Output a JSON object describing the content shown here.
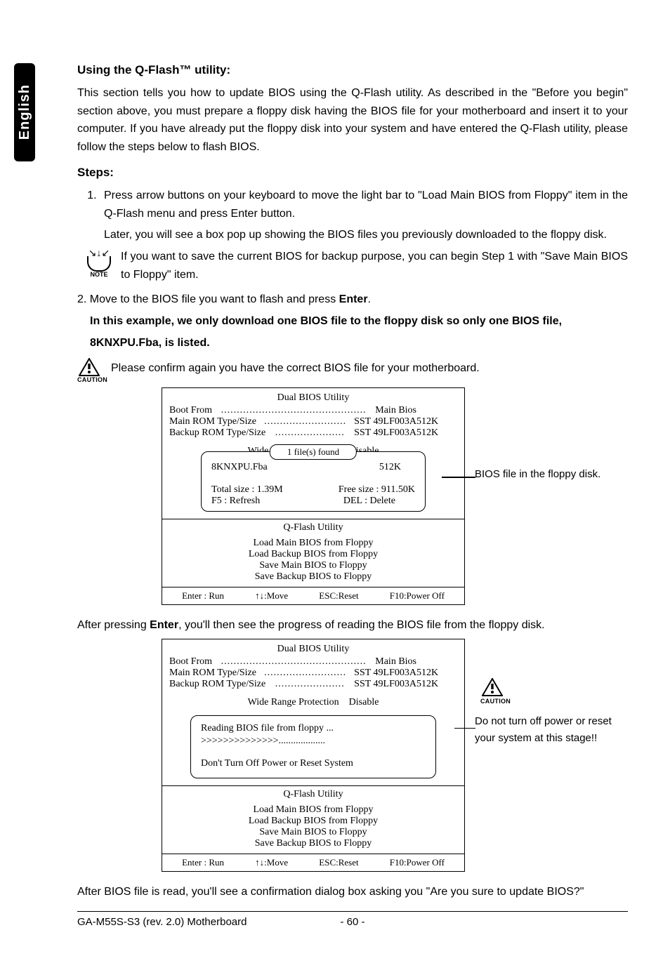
{
  "lang_tab": "English",
  "heading_qflash": "Using the Q-Flash™ utility:",
  "intro": "This section tells you how to update BIOS using the Q-Flash utility. As described in the \"Before you begin\" section above, you must prepare a floppy disk having the BIOS file for your motherboard and insert it to your computer. If you have already put the floppy disk into your system and have entered the Q-Flash utility, please follow the steps below to flash BIOS.",
  "steps_heading": "Steps:",
  "step1_a": "Press arrow buttons on your keyboard to move the light bar to \"Load Main BIOS from Floppy\" item in the Q-Flash menu and press Enter button.",
  "step1_b": "Later, you will see a box pop up showing the BIOS files you previously downloaded to the floppy disk.",
  "note_text": "If you want to save the current BIOS for backup purpose, you can begin Step 1 with \"Save Main BIOS to Floppy\" item.",
  "note_label": "NOTE",
  "step2_line": "2. Move to the BIOS file you want to flash and press ",
  "step2_enter": "Enter",
  "step2_period": ".",
  "bold1": "In this example, we only download one BIOS file to the floppy disk so only one BIOS file,",
  "bold2": "8KNXPU.Fba, is listed.",
  "caution_label": "CAUTION",
  "caution_text": "Please confirm again you have the correct BIOS file for your motherboard.",
  "bios": {
    "title": "Dual BIOS Utility",
    "bootfrom_l": "Boot From",
    "bootfrom_r": "Main Bios",
    "mainrom_l": "Main ROM Type/Size",
    "mainrom_m": "SST 49LF003A",
    "mainrom_r": "512K",
    "bkrom_l": "Backup ROM Type/Size",
    "bkrom_m": "SST 49LF003A",
    "bkrom_r": "512K",
    "wide_l": "Wide Range Protection",
    "wide_r": "Disable",
    "files_found": "1 file(s) found",
    "file_name": "8KNXPU.Fba",
    "file_size": "512K",
    "total": "Total size : 1.39M",
    "free": "Free size : 911.50K",
    "f5": "F5 : Refresh",
    "del": "DEL : Delete",
    "util": "Q-Flash Utility",
    "m1": "Load Main BIOS from Floppy",
    "m2": "Load Backup BIOS from Floppy",
    "m3": "Save Main BIOS to Floppy",
    "m4": "Save Backup BIOS to Floppy",
    "a1": "Enter : Run",
    "a2": "↑↓:Move",
    "a3": "ESC:Reset",
    "a4": "F10:Power Off",
    "reading": "Reading BIOS file from floppy ...",
    "progress": ">>>>>>>>>>>>>>...................",
    "dont_off": "Don't Turn Off Power or Reset System"
  },
  "side_note_1": "BIOS file in the floppy disk.",
  "after_enter_a": "After pressing ",
  "after_enter_b": "Enter",
  "after_enter_c": ", you'll then see the progress of reading the BIOS file from the floppy disk.",
  "side_note_2": "Do not turn off power or reset your system at this stage!!",
  "after_read": "After BIOS file is read, you'll see a confirmation dialog box asking you \"Are you sure to update BIOS?\"",
  "footer_l": "GA-M55S-S3 (rev. 2.0) Motherboard",
  "footer_c": "- 60 -"
}
